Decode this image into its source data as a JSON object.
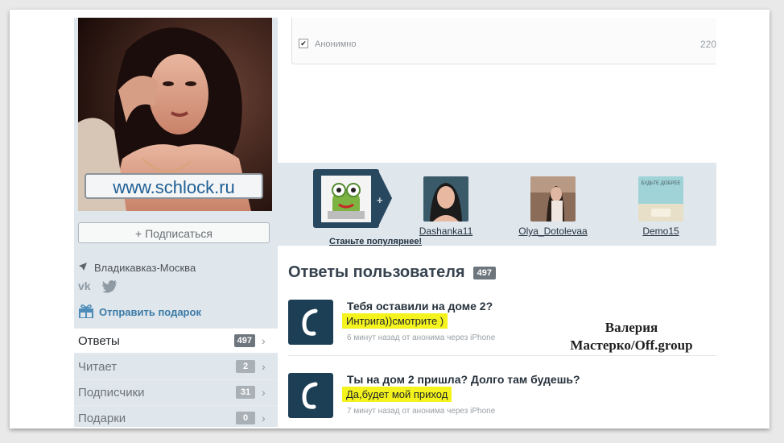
{
  "profile": {
    "watermark": "www.schlock.ru",
    "subscribe_label": "+ Подписаться",
    "location": "Владикавказ-Москва",
    "socials": [
      "vk-icon",
      "twitter-icon"
    ],
    "gift_label": "Отправить подарок"
  },
  "nav": [
    {
      "label": "Ответы",
      "count": "497",
      "active": true
    },
    {
      "label": "Читает",
      "count": "2"
    },
    {
      "label": "Подписчики",
      "count": "31"
    },
    {
      "label": "Подарки",
      "count": "0"
    }
  ],
  "ask": {
    "anonymous_label": "Анонимно",
    "char_count": "220",
    "anonymous_checked": true
  },
  "popular": {
    "promo_label": "Станьте популярнее!",
    "users": [
      {
        "name": "Dashanka11"
      },
      {
        "name": "Olya_Dotolevaa"
      },
      {
        "name": "Demo15",
        "avatar_text": "БУДЬТЕ ДОБРЕЕ"
      }
    ]
  },
  "answers": {
    "title": "Ответы пользователя",
    "count": "497",
    "items": [
      {
        "question": "Тебя оставили на доме 2?",
        "answer": "Интрига))смотрите )",
        "meta": "6 минут назад от анонима через iPhone"
      },
      {
        "question": "Ты на дом 2 пришла? Долго там будешь?",
        "answer": "Да,будет мой приход",
        "meta": "7 минут назад от анонима через iPhone"
      }
    ]
  },
  "credit": {
    "line1": "Валерия",
    "line2": "Мастерко/Off.group"
  },
  "colors": {
    "sidebar_bg": "#dfe6ec",
    "accent": "#1d3f55",
    "highlight": "#f5f31e",
    "link": "#3d7ba6"
  }
}
